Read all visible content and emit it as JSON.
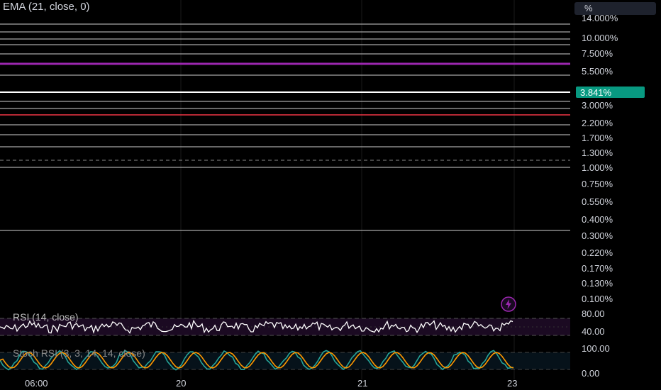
{
  "indicator": {
    "label": "EMA (21, close, 0)"
  },
  "axis": {
    "unit": "%",
    "ticks": [
      "14.000%",
      "10.000%",
      "7.500%",
      "5.500%",
      "3.000%",
      "2.200%",
      "1.700%",
      "1.300%",
      "1.000%",
      "0.750%",
      "0.550%",
      "0.400%",
      "0.300%",
      "0.220%",
      "0.170%",
      "0.130%",
      "0.100%"
    ],
    "current": "3.841%",
    "current_color": "#089981"
  },
  "rsi": {
    "label": "RSI (14, close)",
    "ticks": [
      "80.00",
      "40.00"
    ]
  },
  "stoch": {
    "label": "Stoch RSI (3, 3, 14, 14, close)",
    "ticks": [
      "100.00",
      "0.00"
    ]
  },
  "time_axis": [
    "06:00",
    "20",
    "21",
    "23"
  ],
  "colors": {
    "purple": "#9c27b0",
    "red": "#f23645",
    "teal": "#26a69a",
    "orange": "#ff9800"
  }
}
